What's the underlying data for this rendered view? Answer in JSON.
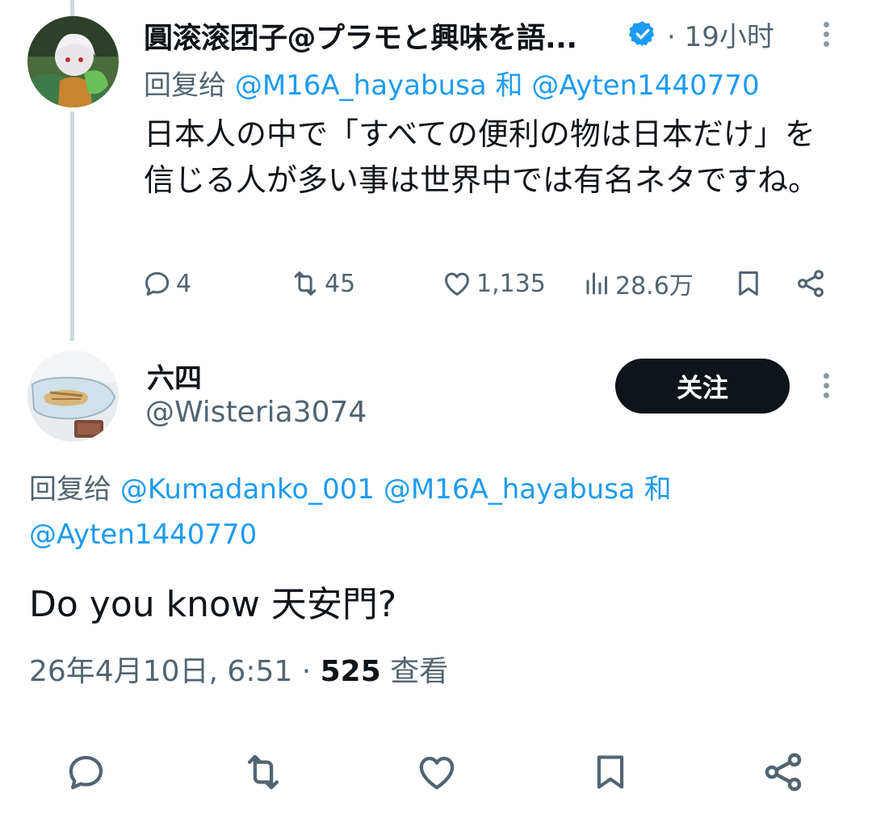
{
  "parent_tweet": {
    "display_name": "圓滚滚团子@プラモと興味を語...",
    "verified": true,
    "meta": "· 19小时",
    "reply_prefix": "回复给",
    "reply_mention_1": "@M16A_hayabusa",
    "reply_and": "和",
    "reply_mention_2": "@Ayten1440770",
    "text": "日本人の中で「すべての便利の物は日本だけ」を信じる人が多い事は世界中では有名ネタですね。",
    "replies": "4",
    "retweets": "45",
    "likes": "1,135",
    "views": "28.6万"
  },
  "main_tweet": {
    "display_name": "六四",
    "handle": "@Wisteria3074",
    "follow_label": "关注",
    "reply_prefix": "回复给",
    "reply_mention_1": "@Kumadanko_001",
    "reply_mention_2": "@M16A_hayabusa",
    "reply_and": "和",
    "reply_mention_3": "@Ayten1440770",
    "text": "Do you know 天安門?",
    "timestamp": "26年4月10日, 6:51 ·",
    "views_count": "525",
    "views_label": "查看"
  },
  "colors": {
    "accent": "#1d9bf0",
    "text": "#0f1419",
    "secondary": "#536471",
    "thread_line": "#cfd9de",
    "button_bg": "#0f1419"
  }
}
